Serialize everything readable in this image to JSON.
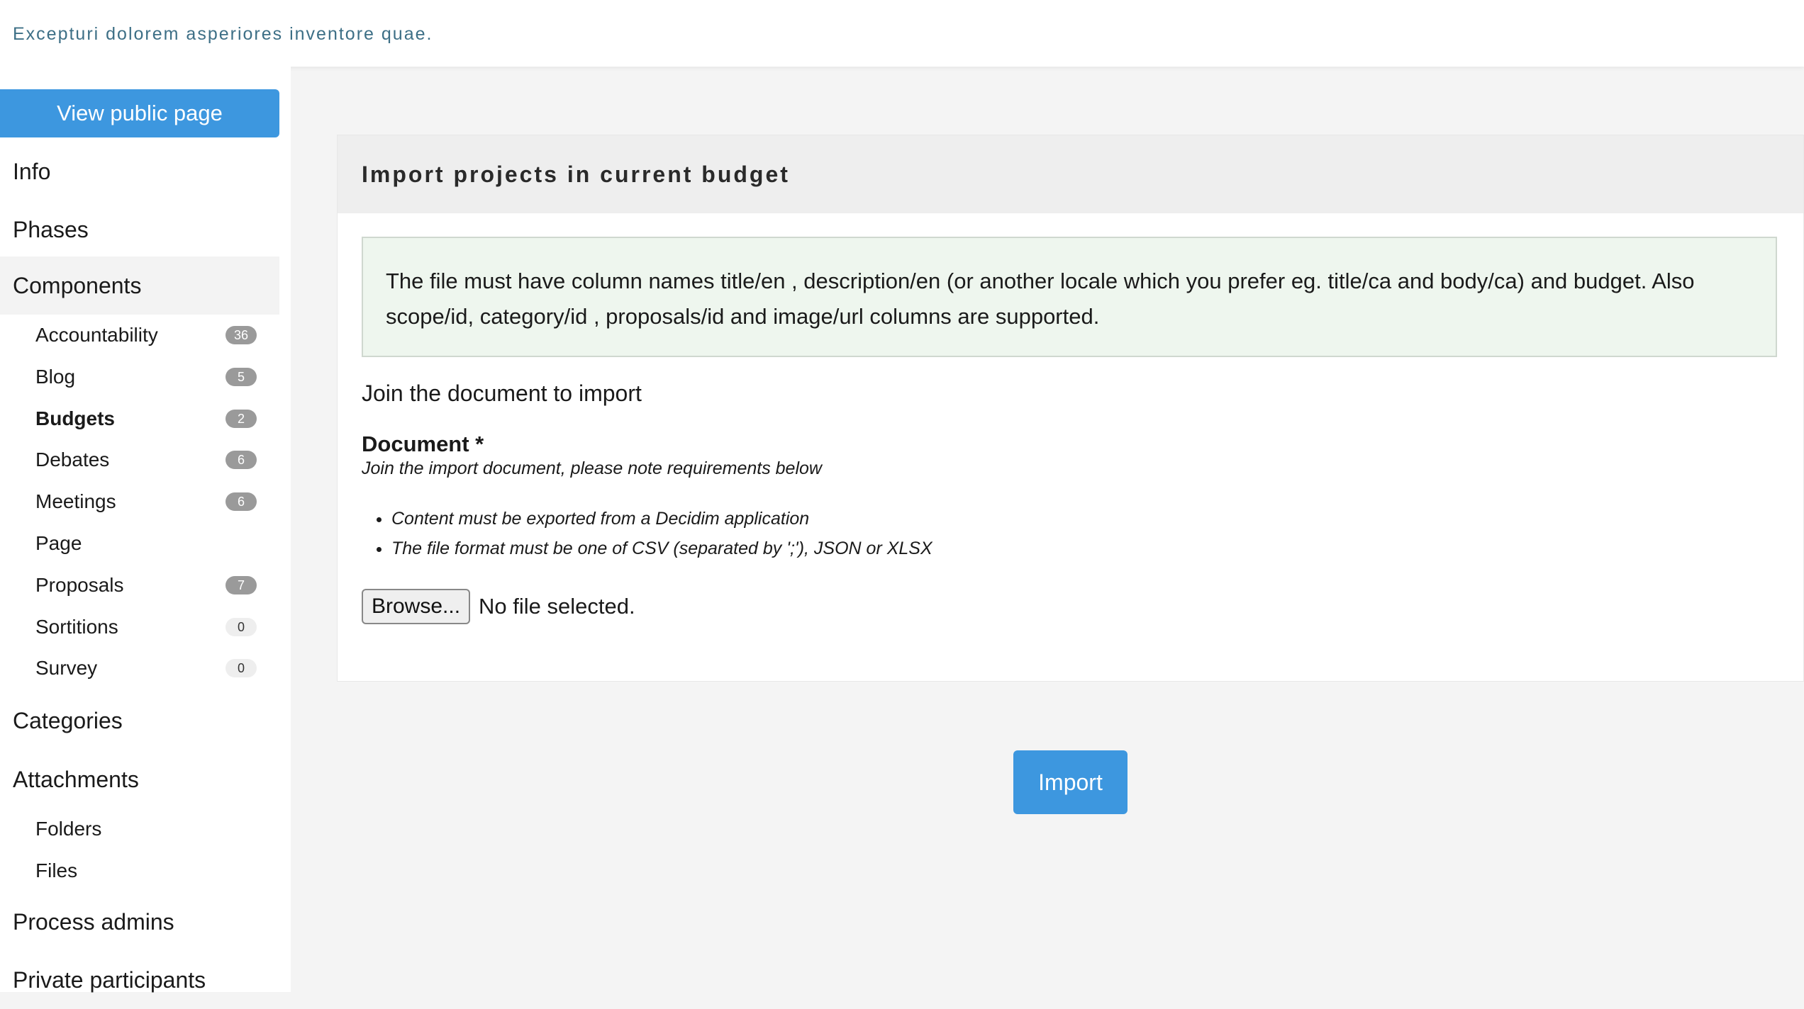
{
  "header": {
    "subtitle": "Excepturi dolorem asperiores inventore quae."
  },
  "sidebar": {
    "view_public_label": "View public page",
    "info": "Info",
    "phases": "Phases",
    "components": "Components",
    "component_items": [
      {
        "label": "Accountability",
        "count": "36"
      },
      {
        "label": "Blog",
        "count": "5"
      },
      {
        "label": "Budgets",
        "count": "2"
      },
      {
        "label": "Debates",
        "count": "6"
      },
      {
        "label": "Meetings",
        "count": "6"
      },
      {
        "label": "Page"
      },
      {
        "label": "Proposals",
        "count": "7"
      },
      {
        "label": "Sortitions",
        "count": "0"
      },
      {
        "label": "Survey",
        "count": "0"
      }
    ],
    "categories": "Categories",
    "attachments": "Attachments",
    "attachment_items": [
      {
        "label": "Folders"
      },
      {
        "label": "Files"
      }
    ],
    "process_admins": "Process admins",
    "private_participants": "Private participants"
  },
  "main": {
    "card_title": "Import projects in current budget",
    "callout_text": "The file must have column names title/en , description/en (or another locale which you prefer eg. title/ca and body/ca) and budget. Also scope/id, category/id , proposals/id and image/url columns are supported.",
    "section_label": "Join the document to import",
    "document_label": "Document *",
    "document_help": "Join the import document, please note requirements below",
    "requirements": [
      "Content must be exported from a Decidim application",
      "The file format must be one of CSV (separated by ';'), JSON or XLSX"
    ],
    "browse_label": "Browse...",
    "file_status": "No file selected.",
    "import_label": "Import"
  },
  "colors": {
    "accent": "#3d97df",
    "callout_bg": "#eef6ee",
    "header_bg": "#eeeeee"
  }
}
